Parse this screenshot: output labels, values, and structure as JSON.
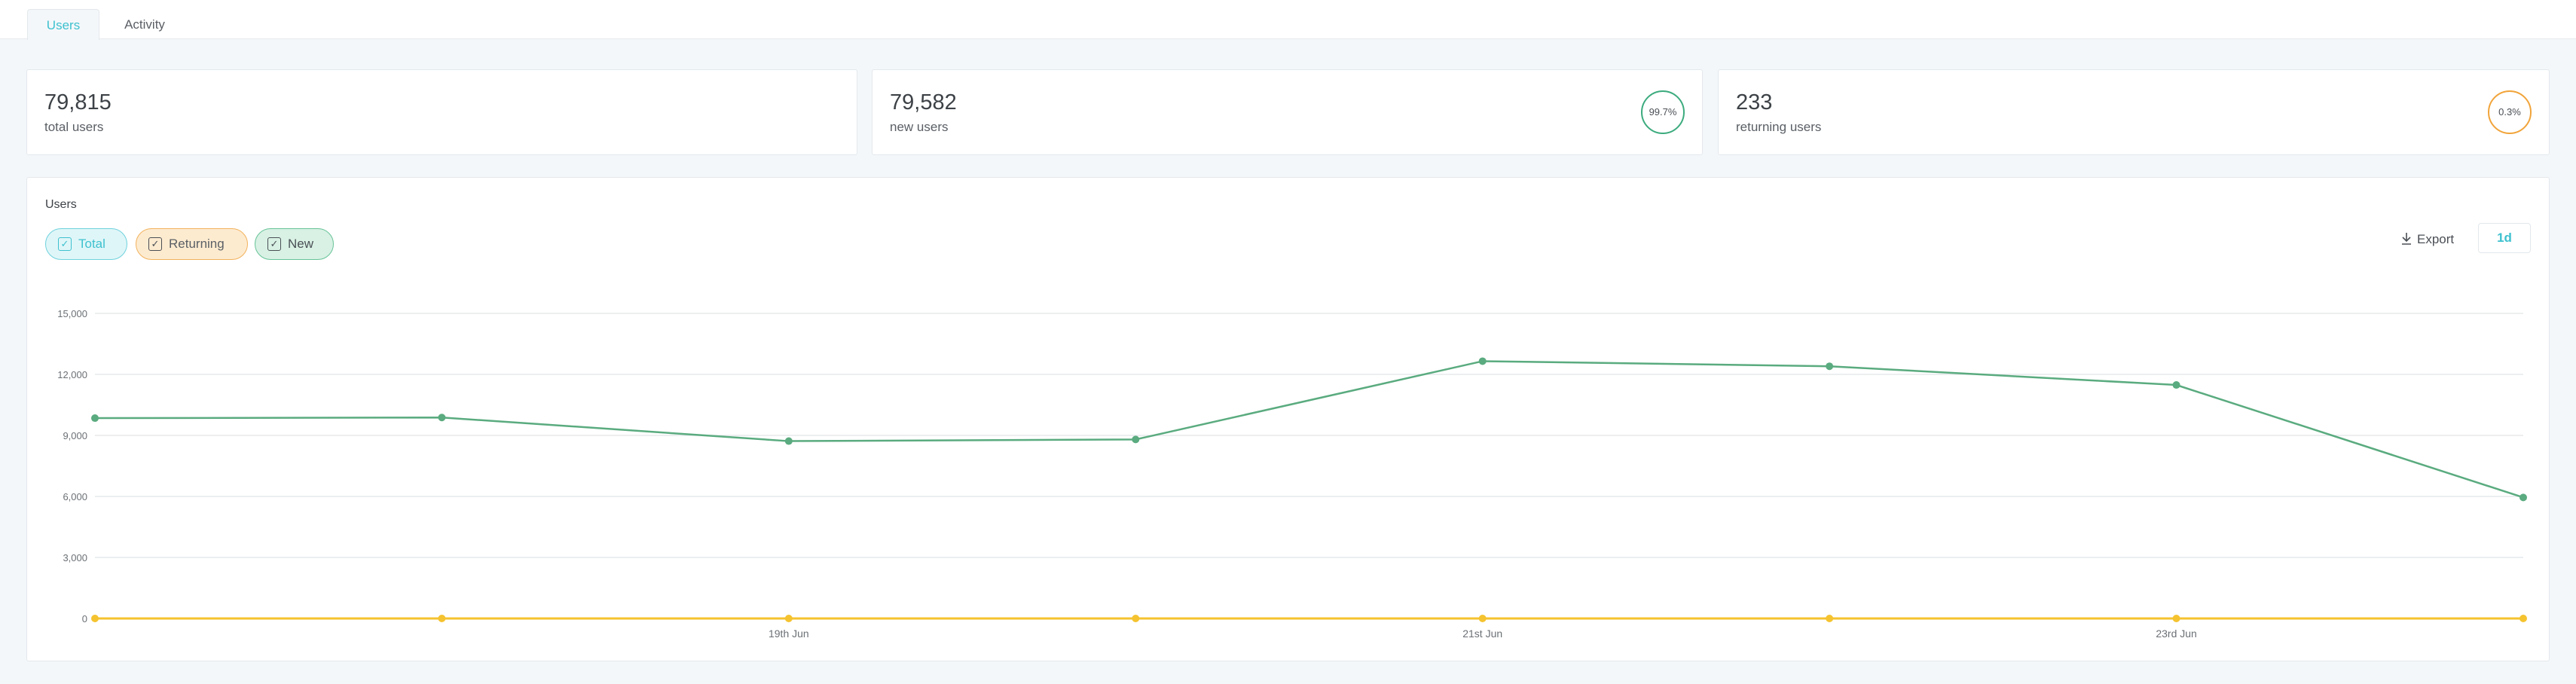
{
  "tabs": [
    {
      "label": "Users",
      "active": true
    },
    {
      "label": "Activity",
      "active": false
    }
  ],
  "stats": {
    "total": {
      "value": "79,815",
      "label": "total users"
    },
    "new": {
      "value": "79,582",
      "label": "new users",
      "percent": "99.7%"
    },
    "returning": {
      "value": "233",
      "label": "returning users",
      "percent": "0.3%"
    }
  },
  "chart_panel": {
    "title": "Users",
    "toggles": [
      {
        "label": "Total",
        "checked": true
      },
      {
        "label": "Returning",
        "checked": true
      },
      {
        "label": "New",
        "checked": true
      }
    ],
    "export_label": "Export",
    "range_label": "1d"
  },
  "colors": {
    "accent": "#3ec1cf",
    "new_series": "#5aab7f",
    "returning_series": "#f5c32f",
    "gridline": "#e6e9ec"
  },
  "chart_data": {
    "type": "line",
    "ylim": [
      0,
      15000
    ],
    "y_ticks": [
      0,
      3000,
      6000,
      9000,
      12000,
      15000
    ],
    "y_tick_labels": [
      "0",
      "3,000",
      "6,000",
      "9,000",
      "12,000",
      "15,000"
    ],
    "x_tick_labels": [
      {
        "index": 2,
        "label": "19th Jun"
      },
      {
        "index": 4,
        "label": "21st Jun"
      },
      {
        "index": 6,
        "label": "23rd Jun"
      }
    ],
    "grid": true,
    "series": [
      {
        "values": [
          9850,
          9880,
          8720,
          8800,
          12650,
          12400,
          11480,
          5950
        ]
      },
      {
        "values": [
          0,
          0,
          0,
          0,
          0,
          0,
          0,
          0
        ]
      }
    ]
  }
}
